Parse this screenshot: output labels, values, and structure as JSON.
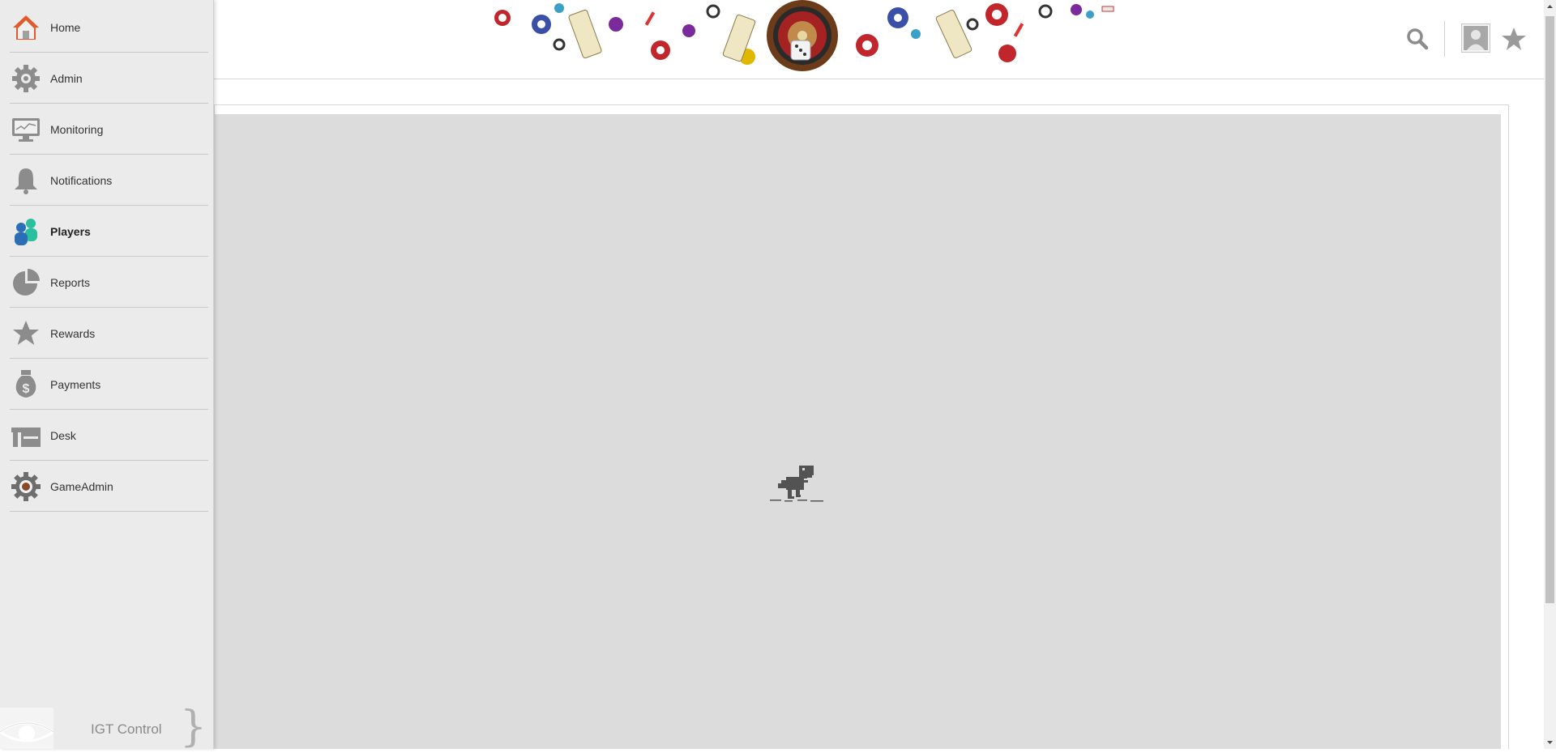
{
  "sidebar": {
    "items": [
      {
        "label": "Home",
        "icon": "home-icon",
        "active": false
      },
      {
        "label": "Admin",
        "icon": "gear-icon",
        "active": false
      },
      {
        "label": "Monitoring",
        "icon": "monitor-icon",
        "active": false
      },
      {
        "label": "Notifications",
        "icon": "bell-icon",
        "active": false
      },
      {
        "label": "Players",
        "icon": "players-icon",
        "active": true
      },
      {
        "label": "Reports",
        "icon": "pie-chart-icon",
        "active": false
      },
      {
        "label": "Rewards",
        "icon": "star-icon",
        "active": false
      },
      {
        "label": "Payments",
        "icon": "money-bag-icon",
        "active": false
      },
      {
        "label": "Desk",
        "icon": "desk-icon",
        "active": false
      },
      {
        "label": "GameAdmin",
        "icon": "game-admin-icon",
        "active": false
      }
    ],
    "brand": {
      "text": "IGT Control"
    }
  },
  "header": {
    "banner_icon": "casino-banner",
    "search_icon": "search-icon",
    "avatar_icon": "avatar",
    "favorite_icon": "star-icon"
  },
  "content": {
    "placeholder_icon": "dino-icon"
  },
  "colors": {
    "sidebar_bg": "#ebebeb",
    "content_bg": "#dcdcdc",
    "icon_gray": "#8c8c8c",
    "home_roof": "#e05a2b",
    "players_blue": "#2a6fb5",
    "players_green": "#2bbfa0"
  }
}
